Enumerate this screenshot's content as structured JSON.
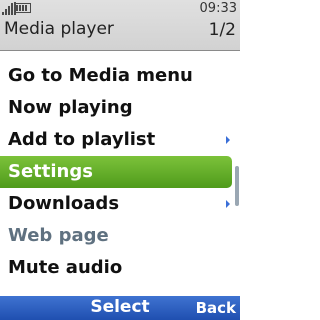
{
  "status": {
    "time": "09:33"
  },
  "header": {
    "title": "Media player",
    "page_indicator": "1/2"
  },
  "menu": {
    "items": [
      {
        "label": "Go to Media menu"
      },
      {
        "label": "Now playing"
      },
      {
        "label": "Add to playlist",
        "has_submenu": true
      },
      {
        "label": "Settings",
        "selected": true
      },
      {
        "label": "Downloads",
        "has_submenu": true
      },
      {
        "label": "Web page",
        "disabled": true
      },
      {
        "label": "Mute audio"
      }
    ]
  },
  "softkeys": {
    "select": "Select",
    "back": "Back"
  },
  "colors": {
    "selection": "#5ea826",
    "softkey_bar": "#2d5fc0",
    "header": "#d6d6d6",
    "submenu_arrow": "#3a6fd8"
  }
}
